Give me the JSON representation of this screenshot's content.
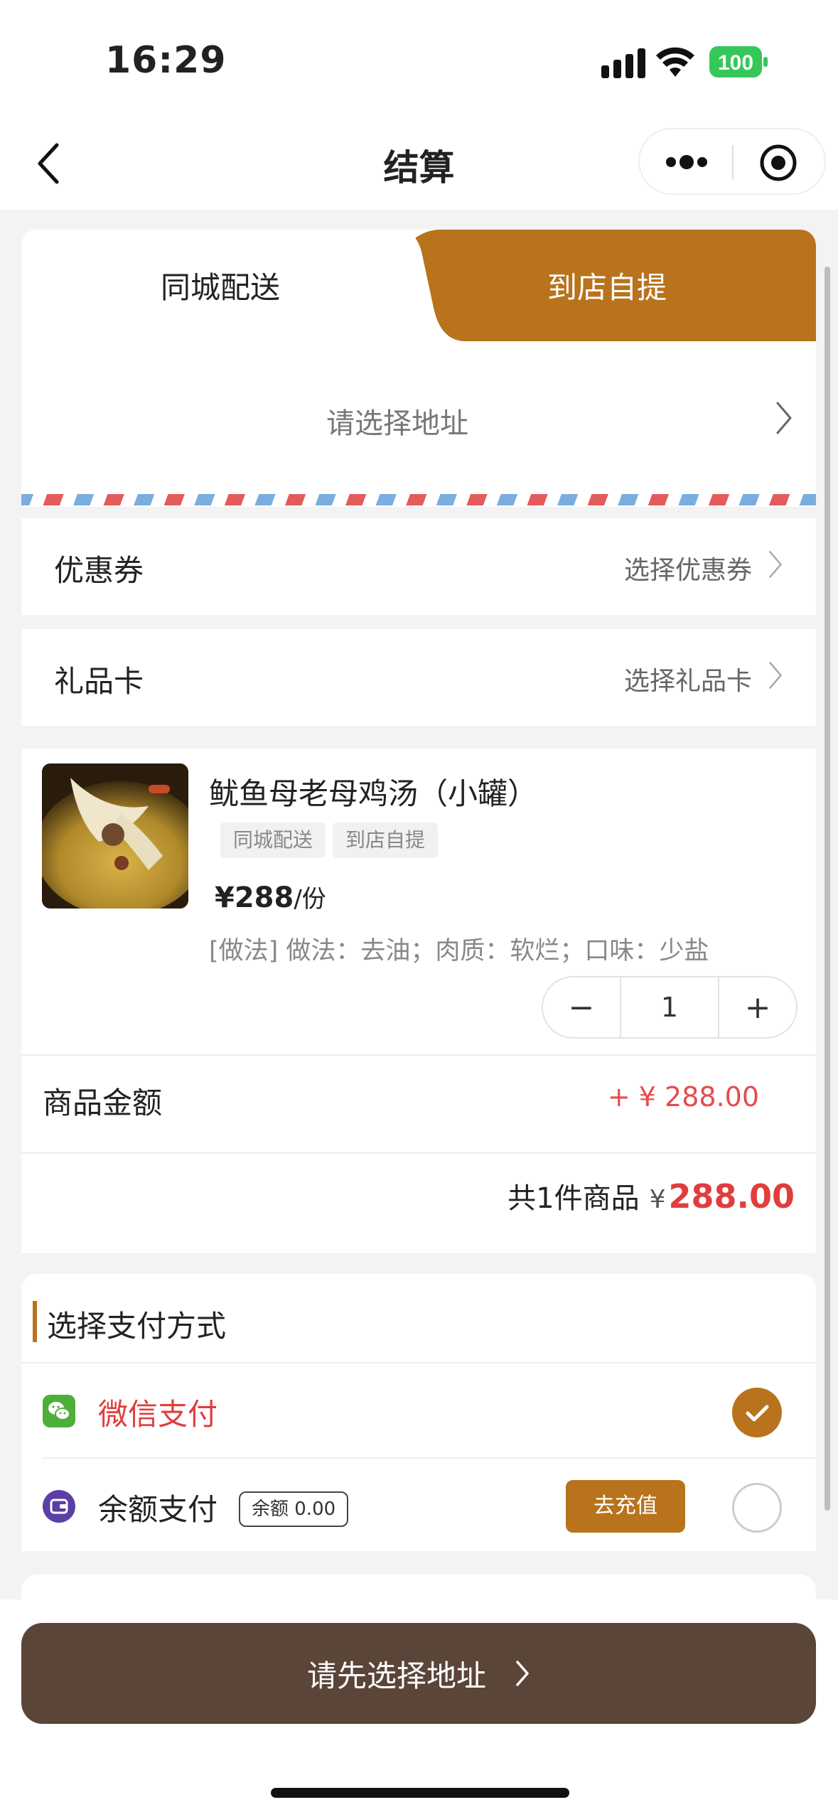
{
  "status_bar": {
    "time": "16:29",
    "battery": "100"
  },
  "nav": {
    "title": "结算"
  },
  "delivery_tabs": [
    {
      "label": "同城配送",
      "selected": false
    },
    {
      "label": "到店自提",
      "selected": true
    }
  ],
  "address": {
    "placeholder": "请选择地址"
  },
  "coupon": {
    "label": "优惠券",
    "value": "选择优惠券"
  },
  "gift_card": {
    "label": "礼品卡",
    "value": "选择礼品卡"
  },
  "goods": {
    "name": "鱿鱼母老母鸡汤（小罐）",
    "tags": [
      "同城配送",
      "到店自提"
    ],
    "price": "¥288",
    "unit": "/份",
    "spec": "[做法] 做法：去油；肉质：软烂；口味：少盐",
    "quantity": "1",
    "minus": "−",
    "plus": "+"
  },
  "amount": {
    "label": "商品金额",
    "value": "+ ¥ 288.00"
  },
  "total": {
    "count_text": "共1件商品",
    "currency": "¥",
    "value": "288.00"
  },
  "payment": {
    "title": "选择支付方式",
    "methods": [
      {
        "name": "微信支付",
        "selected": true,
        "color": "#e13d3d"
      },
      {
        "name": "余额支付",
        "selected": false,
        "balance": "余额 0.00",
        "recharge": "去充值"
      }
    ]
  },
  "submit": {
    "label": "请先选择地址"
  },
  "colors": {
    "accent": "#b8731c",
    "price_red": "#e13d3d",
    "submit_bg": "#5a4538"
  }
}
